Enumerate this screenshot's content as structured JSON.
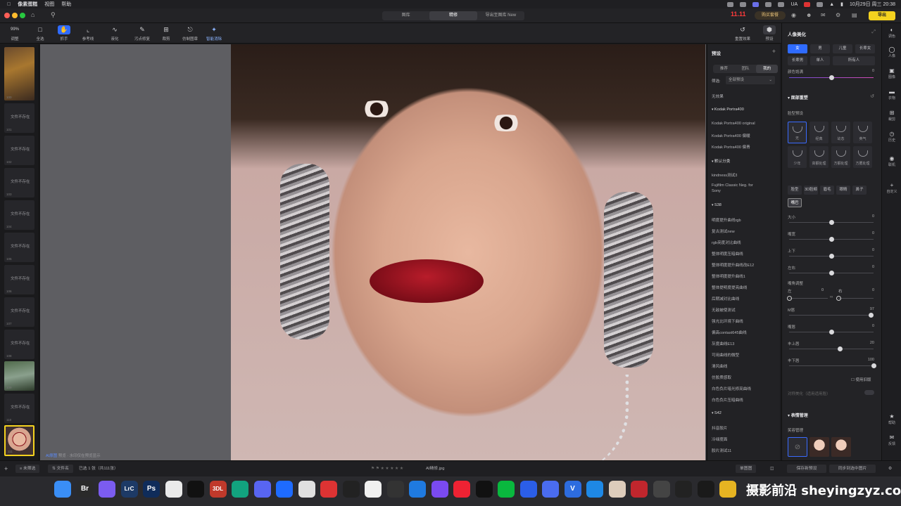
{
  "menubar": {
    "app_name": "像素蛋糕",
    "items": [
      "视图",
      "帮助"
    ],
    "clock": "10月29日 周三 20:38",
    "input_method": "UA"
  },
  "titlebar": {
    "tabs": [
      "图库",
      "精修"
    ],
    "active_tab": "精修",
    "upload_label": "导出至图库 New",
    "promo": "11.11",
    "buy_vip": "购买套餐",
    "export": "导出"
  },
  "toolbar": {
    "zoom": "99%",
    "tools": [
      {
        "label": "调整",
        "icon": "zoom-icon"
      },
      {
        "label": "全选",
        "icon": "select-icon"
      },
      {
        "label": "抓手",
        "icon": "hand-icon"
      },
      {
        "label": "参考线",
        "icon": "guide-icon"
      },
      {
        "label": "液化",
        "icon": "liquify-icon"
      },
      {
        "label": "污点修复",
        "icon": "heal-icon"
      },
      {
        "label": "裁剪",
        "icon": "crop-icon"
      },
      {
        "label": "仿制图章",
        "icon": "stamp-icon"
      },
      {
        "label": "智能消除",
        "icon": "ai-erase-icon"
      }
    ],
    "reset": "重置效果",
    "presets": "预设"
  },
  "filmstrip": {
    "missing": "文件不存在",
    "numbers": [
      "100",
      "101",
      "102",
      "103",
      "104",
      "105",
      "106",
      "107",
      "108",
      "109",
      "110",
      "111"
    ]
  },
  "canvas": {
    "hint_blue": "AI原图",
    "hint_rest": "预览  ·  水印仅在预览显示"
  },
  "presets_panel": {
    "title": "预设",
    "tabs": [
      "推荐",
      "团队",
      "我的"
    ],
    "filter_label": "筛选:",
    "filter_value": "全部预设",
    "items": [
      {
        "text": "无效果",
        "group": false
      },
      {
        "text": "Kodak Portra400",
        "group": true
      },
      {
        "text": "Kodak Portra400 original",
        "group": false
      },
      {
        "text": "Kodak Portra400 偏暖",
        "group": false
      },
      {
        "text": "Kodak Portra400 偏青",
        "group": false
      },
      {
        "text": "默认分类",
        "group": true
      },
      {
        "text": "kindness测试3",
        "group": false
      },
      {
        "text": "Fujifilm Classic Neg. for",
        "group": false
      },
      {
        "text": "Sony",
        "group": false
      },
      {
        "text": "S38",
        "group": true
      },
      {
        "text": "明度提升曲线rgb",
        "group": false
      },
      {
        "text": "复古测试new",
        "group": false
      },
      {
        "text": "rgb亮度对比曲线",
        "group": false
      },
      {
        "text": "整体明度压暗曲线",
        "group": false
      },
      {
        "text": "整体明度提升曲线改E12",
        "group": false
      },
      {
        "text": "整体明度提升曲线1",
        "group": false
      },
      {
        "text": "整体提明度提亮曲线",
        "group": false
      },
      {
        "text": "后期减对比曲线",
        "group": false
      },
      {
        "text": "无敌被使测试",
        "group": false
      },
      {
        "text": "强光比环境下曲线",
        "group": false
      },
      {
        "text": "偏高contast645曲线",
        "group": false
      },
      {
        "text": "灰度曲线E13",
        "group": false
      },
      {
        "text": "可用曲线的微型",
        "group": false
      },
      {
        "text": "清风曲线",
        "group": false
      },
      {
        "text": "仿胶质感取",
        "group": false
      },
      {
        "text": "白色负片暗光修亮曲线",
        "group": false
      },
      {
        "text": "白色负片压暗曲线",
        "group": false
      },
      {
        "text": "S42",
        "group": true
      },
      {
        "text": "抖音胶片",
        "group": false
      },
      {
        "text": "冷绿度面",
        "group": false
      },
      {
        "text": "胶片测试11",
        "group": false
      }
    ]
  },
  "right_panel": {
    "title": "人像美化",
    "gender_buttons": [
      "女",
      "男",
      "儿童",
      "长辈女",
      "长辈男",
      "单人",
      "所有人"
    ],
    "active_gender": "女",
    "top_slider": {
      "label": "颜色饱满",
      "value": "0",
      "fraction": 0.5
    },
    "section_face": "面部重塑",
    "face_presets_label": "脸型预设",
    "face_shapes": [
      "无",
      "经典",
      "幼态",
      "英气",
      "少年",
      "高颧处理",
      "方颧处理",
      "方腮处理"
    ],
    "face_parts": [
      "脸型",
      "3D脸颊",
      "眉毛",
      "眼睛",
      "鼻子",
      "嘴巴"
    ],
    "active_part": "嘴巴",
    "sliders": [
      {
        "label": "大小",
        "value": "0",
        "fraction": 0.5
      },
      {
        "label": "嘴宽",
        "value": "0",
        "fraction": 0.5
      },
      {
        "label": "上下",
        "value": "0",
        "fraction": 0.5
      },
      {
        "label": "左右",
        "value": "0",
        "fraction": 0.5
      }
    ],
    "asym_label": "嘴角调整",
    "asym_left_label": "左",
    "asym_left_value": "0",
    "asym_right_label": "右",
    "asym_right_value": "0",
    "sliders2": [
      {
        "label": "M唇",
        "value": "97",
        "fraction": 0.97
      },
      {
        "label": "嘴唇",
        "value": "0",
        "fraction": 0.5
      },
      {
        "label": "丰上唇",
        "value": "20",
        "fraction": 0.6
      },
      {
        "label": "丰下唇",
        "value": "100",
        "fraction": 1.0
      }
    ],
    "use_tag": "使用旧版",
    "symmetry": "对称美化（适用适用脸）",
    "section_expression": "表情管理",
    "smile_label": "笑容管理"
  },
  "right_strip": {
    "items": [
      {
        "label": "调色",
        "icon": "palette-icon"
      },
      {
        "label": "人像",
        "icon": "portrait-icon"
      },
      {
        "label": "图像",
        "icon": "image-icon"
      },
      {
        "label": "衣物",
        "icon": "clothes-icon"
      },
      {
        "label": "裁剪",
        "icon": "crop-icon"
      },
      {
        "label": "历史",
        "icon": "history-icon"
      },
      {
        "label": "联机",
        "icon": "camera-icon"
      },
      {
        "label": "自定义",
        "icon": "plus-icon"
      },
      {
        "label": "帮助",
        "icon": "help-icon"
      },
      {
        "label": "反馈",
        "icon": "feedback-icon"
      }
    ]
  },
  "bottombar": {
    "filter": "未筛选",
    "sort": "文件名",
    "selected": "已选 1 张（共111张）",
    "filename": "AI精修.jpg",
    "single_image": "单图图",
    "save_preset": "保存新预设",
    "sync": "同步到选中图片"
  },
  "dock": {
    "apps": [
      "Finder",
      "Br",
      "Launchpad",
      "LrC",
      "Ps",
      "Chrome",
      "CapCut",
      "3DL",
      "ChatGPT",
      "Discord",
      "Lark",
      "Game",
      "Netease",
      "Clock",
      "Chrome2",
      "Settings",
      "Edge",
      "Mindmap",
      "Sogou",
      "QQ",
      "WeChat",
      "Baidu",
      "Video",
      "V",
      "Safari",
      "Avatar",
      "Netease2",
      "Cam",
      "Clock2",
      "Siri",
      "Folder"
    ],
    "watermark": "摄影前沿 sheyingzyz.com"
  }
}
